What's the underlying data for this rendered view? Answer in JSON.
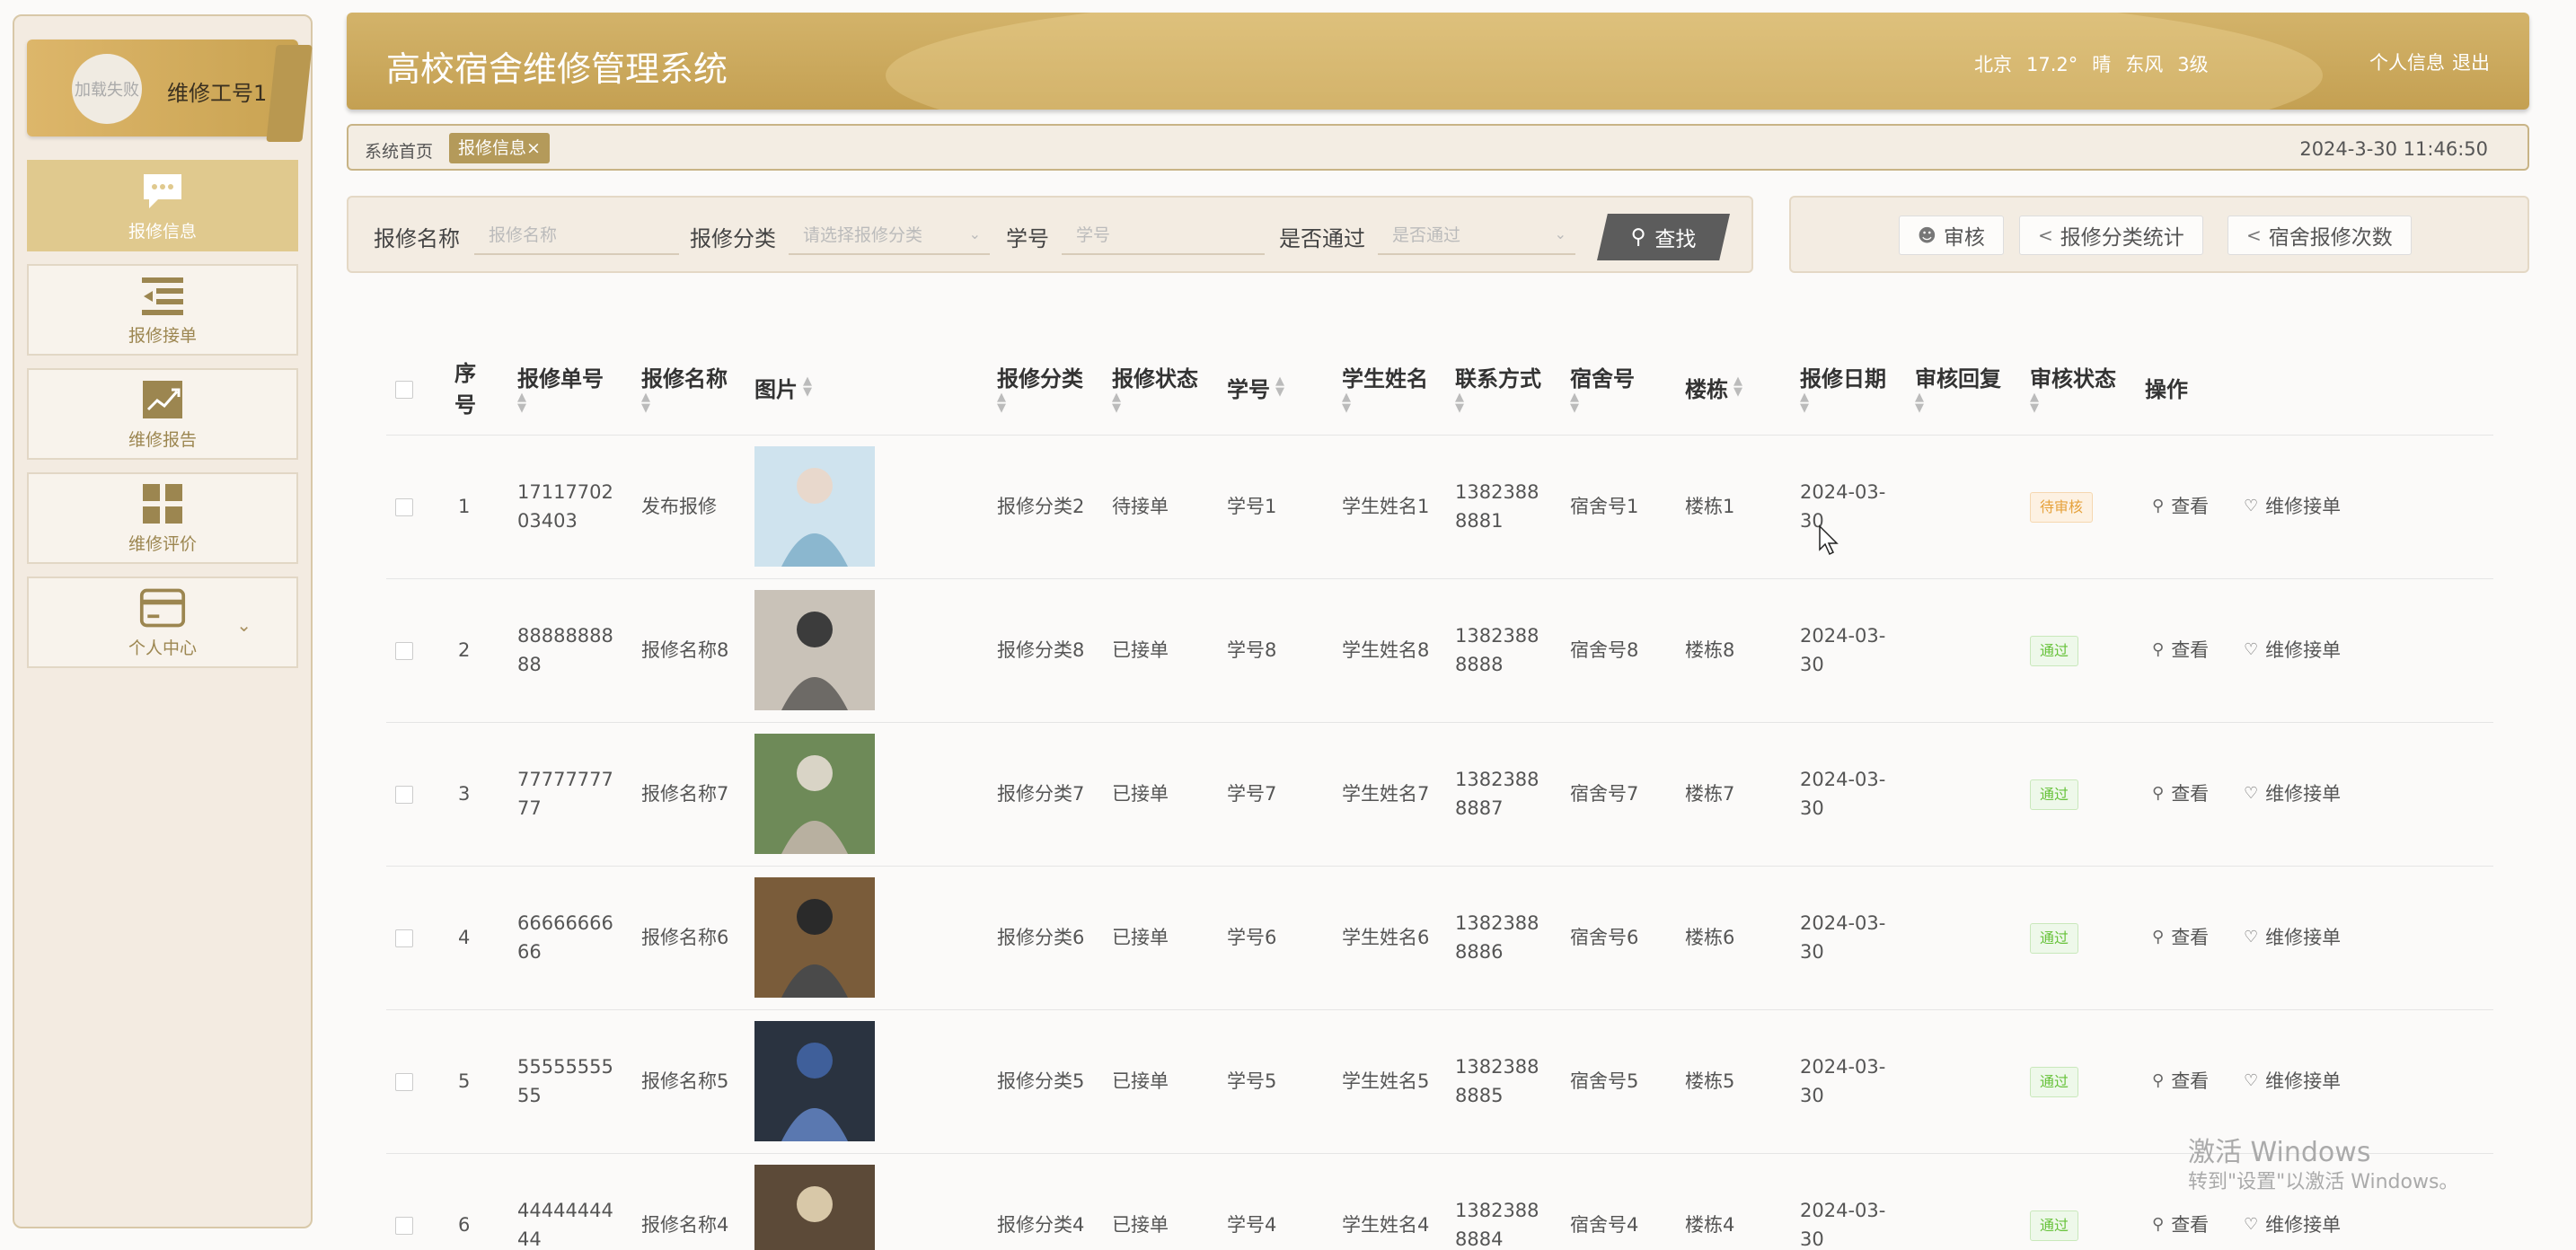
{
  "sidebar": {
    "avatar_text": "加载失败",
    "user_name": "维修工号1",
    "items": [
      {
        "label": "报修信息",
        "icon": "chat-bubble-icon"
      },
      {
        "label": "报修接单",
        "icon": "list-indent-icon"
      },
      {
        "label": "维修报告",
        "icon": "trend-chart-icon"
      },
      {
        "label": "维修评价",
        "icon": "grid-icon"
      },
      {
        "label": "个人中心",
        "icon": "card-icon"
      }
    ]
  },
  "header": {
    "title": "高校宿舍维修管理系统",
    "weather": {
      "city": "北京",
      "temp": "17.2°",
      "condition": "晴",
      "wind": "东风",
      "level": "3级"
    },
    "profile_link": "个人信息",
    "logout_link": "退出"
  },
  "breadcrumb": {
    "home": "系统首页",
    "tab": "报修信息",
    "close": "×",
    "datetime": "2024-3-30 11:46:50"
  },
  "search": {
    "name_label": "报修名称",
    "name_placeholder": "报修名称",
    "category_label": "报修分类",
    "category_placeholder": "请选择报修分类",
    "student_label": "学号",
    "student_placeholder": "学号",
    "pass_label": "是否通过",
    "pass_placeholder": "是否通过",
    "search_button": "查找"
  },
  "actions": {
    "audit": "审核",
    "category_stats": "报修分类统计",
    "dorm_stats": "宿舍报修次数"
  },
  "table": {
    "headers": {
      "index": "序号",
      "order_no": "报修单号",
      "name": "报修名称",
      "image": "图片",
      "category": "报修分类",
      "status": "报修状态",
      "student_no": "学号",
      "student_name": "学生姓名",
      "phone": "联系方式",
      "dorm": "宿舍号",
      "building": "楼栋",
      "date": "报修日期",
      "reply": "审核回复",
      "audit_status": "审核状态",
      "ops": "操作"
    },
    "view_label": "查看",
    "repair_label": "维修接单",
    "rows": [
      {
        "index": "1",
        "order_no": "1711770203403",
        "name": "发布报修",
        "category": "报修分类2",
        "status": "待接单",
        "student_no": "学号1",
        "student_name": "学生姓名1",
        "phone": "13823888881",
        "dorm": "宿舍号1",
        "building": "楼栋1",
        "date": "2024-03-30",
        "audit": "待审核",
        "audit_type": "pending"
      },
      {
        "index": "2",
        "order_no": "8888888888",
        "name": "报修名称8",
        "category": "报修分类8",
        "status": "已接单",
        "student_no": "学号8",
        "student_name": "学生姓名8",
        "phone": "13823888888",
        "dorm": "宿舍号8",
        "building": "楼栋8",
        "date": "2024-03-30",
        "audit": "通过",
        "audit_type": "pass"
      },
      {
        "index": "3",
        "order_no": "7777777777",
        "name": "报修名称7",
        "category": "报修分类7",
        "status": "已接单",
        "student_no": "学号7",
        "student_name": "学生姓名7",
        "phone": "13823888887",
        "dorm": "宿舍号7",
        "building": "楼栋7",
        "date": "2024-03-30",
        "audit": "通过",
        "audit_type": "pass"
      },
      {
        "index": "4",
        "order_no": "6666666666",
        "name": "报修名称6",
        "category": "报修分类6",
        "status": "已接单",
        "student_no": "学号6",
        "student_name": "学生姓名6",
        "phone": "13823888886",
        "dorm": "宿舍号6",
        "building": "楼栋6",
        "date": "2024-03-30",
        "audit": "通过",
        "audit_type": "pass"
      },
      {
        "index": "5",
        "order_no": "5555555555",
        "name": "报修名称5",
        "category": "报修分类5",
        "status": "已接单",
        "student_no": "学号5",
        "student_name": "学生姓名5",
        "phone": "13823888885",
        "dorm": "宿舍号5",
        "building": "楼栋5",
        "date": "2024-03-30",
        "audit": "通过",
        "audit_type": "pass"
      },
      {
        "index": "6",
        "order_no": "4444444444",
        "name": "报修名称4",
        "category": "报修分类4",
        "status": "已接单",
        "student_no": "学号4",
        "student_name": "学生姓名4",
        "phone": "13823888884",
        "dorm": "宿舍号4",
        "building": "楼栋4",
        "date": "2024-03-30",
        "audit": "通过",
        "audit_type": "pass"
      }
    ]
  },
  "watermark": {
    "line1": "激活 Windows",
    "line2": "转到\"设置\"以激活 Windows。"
  },
  "colors": {
    "gold": "#c9a552",
    "pending": "#e6a23c",
    "pass": "#67c23a"
  }
}
